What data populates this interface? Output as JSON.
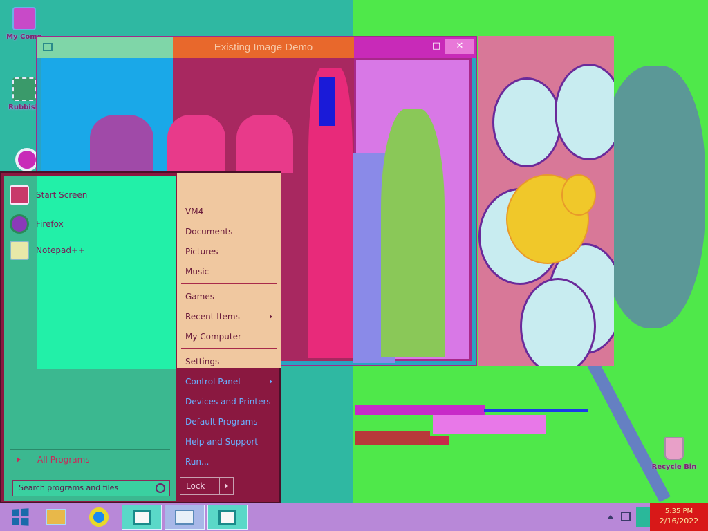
{
  "desktop": {
    "icons": [
      {
        "label": "My Comp",
        "name": "desktop-icon-my-computer"
      },
      {
        "label": "Rubbish",
        "name": "desktop-icon-qr"
      },
      {
        "label": "",
        "name": "desktop-icon-chrome"
      },
      {
        "label": "Recycle Bin",
        "name": "desktop-icon-recycle-bin"
      }
    ]
  },
  "app_window": {
    "title": "Existing Image Demo",
    "controls": {
      "minimize": "–",
      "maximize": "□",
      "close": "✕"
    }
  },
  "start_menu": {
    "pinned": [
      {
        "label": "Start Screen",
        "icon": "start-screen-icon"
      },
      {
        "label": "Firefox",
        "icon": "firefox-icon"
      },
      {
        "label": "Notepad++",
        "icon": "notepad-icon"
      }
    ],
    "all_programs": "All Programs",
    "search_placeholder": "Search programs and files",
    "right": {
      "group1": [
        "VM4",
        "Documents",
        "Pictures",
        "Music"
      ],
      "group2": [
        "Games",
        "Recent Items",
        "My Computer"
      ],
      "group3": [
        "Settings",
        "Control Panel",
        "Devices and Printers",
        "Default Programs",
        "Help and Support",
        "Run..."
      ]
    },
    "lock_label": "Lock"
  },
  "taskbar": {
    "clock_time": "5:35 PM",
    "clock_date": "2/16/2022",
    "items": [
      "start-button",
      "file-explorer",
      "chrome",
      "app-window",
      "task-manager",
      "app-window-2"
    ]
  },
  "colors": {
    "accent": "#e8682c",
    "start_bg": "#8a1840",
    "taskbar": "#b888d8"
  }
}
